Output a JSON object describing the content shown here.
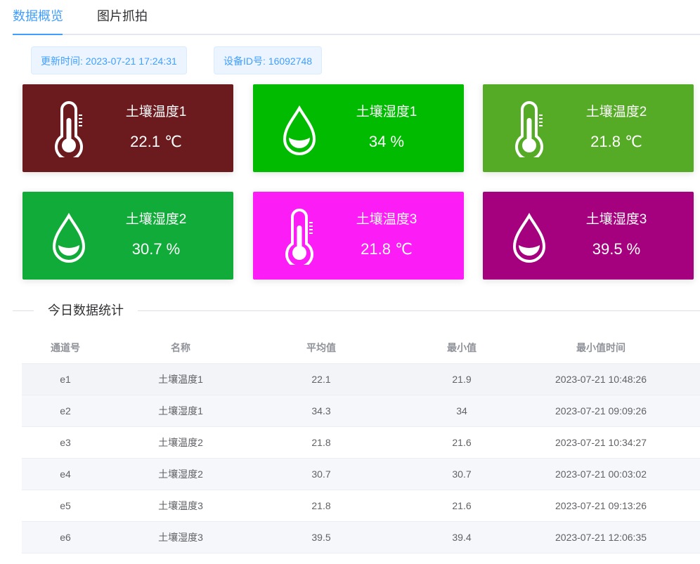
{
  "tabs": [
    {
      "label": "数据概览",
      "active": true
    },
    {
      "label": "图片抓拍",
      "active": false
    }
  ],
  "info": {
    "update_time": "更新时间: 2023-07-21 17:24:31",
    "device_id": "设备ID号: 16092748"
  },
  "cards": [
    {
      "name": "土壤温度1",
      "value": "22.1 ℃",
      "icon": "thermometer-icon",
      "color": "#6b1a1e"
    },
    {
      "name": "土壤湿度1",
      "value": "34 %",
      "icon": "water-drop-icon",
      "color": "#00bb00"
    },
    {
      "name": "土壤温度2",
      "value": "21.8 ℃",
      "icon": "thermometer-icon",
      "color": "#55ab25"
    },
    {
      "name": "土壤湿度2",
      "value": "30.7 %",
      "icon": "water-drop-icon",
      "color": "#11ab3a"
    },
    {
      "name": "土壤温度3",
      "value": "21.8 ℃",
      "icon": "thermometer-icon",
      "color": "#fb1cf6"
    },
    {
      "name": "土壤湿度3",
      "value": "39.5 %",
      "icon": "water-drop-icon",
      "color": "#a5007d"
    }
  ],
  "stats": {
    "title": "今日数据统计",
    "columns": [
      "通道号",
      "名称",
      "平均值",
      "最小值",
      "最小值时间"
    ],
    "rows": [
      [
        "e1",
        "土壤温度1",
        "22.1",
        "21.9",
        "2023-07-21 10:48:26"
      ],
      [
        "e2",
        "土壤湿度1",
        "34.3",
        "34",
        "2023-07-21 09:09:26"
      ],
      [
        "e3",
        "土壤温度2",
        "21.8",
        "21.6",
        "2023-07-21 10:34:27"
      ],
      [
        "e4",
        "土壤湿度2",
        "30.7",
        "30.7",
        "2023-07-21 00:03:02"
      ],
      [
        "e5",
        "土壤温度3",
        "21.8",
        "21.6",
        "2023-07-21 09:13:26"
      ],
      [
        "e6",
        "土壤湿度3",
        "39.5",
        "39.4",
        "2023-07-21 12:06:35"
      ]
    ]
  },
  "colors": {
    "accent": "#409eff",
    "tag_bg": "#ecf5ff",
    "tag_border": "#d9ecff"
  }
}
